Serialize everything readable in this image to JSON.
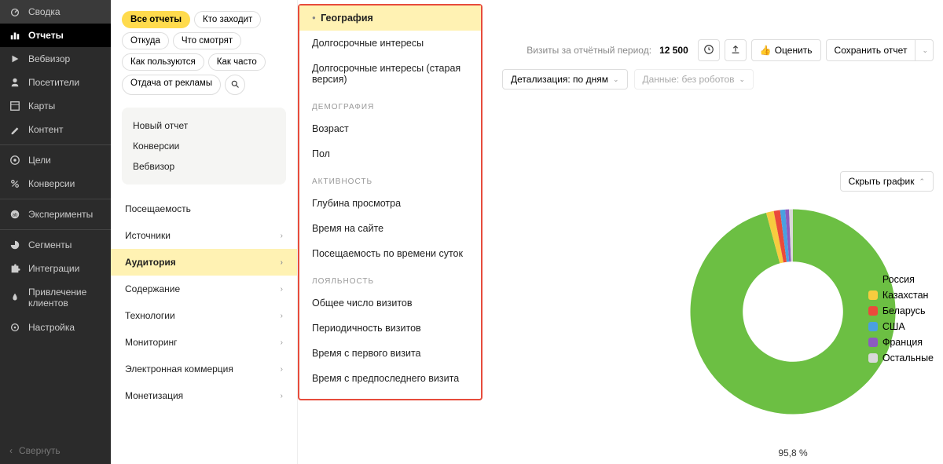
{
  "sidebar": {
    "items": [
      {
        "label": "Сводка",
        "icon": "gauge"
      },
      {
        "label": "Отчеты",
        "icon": "bars",
        "active": true
      },
      {
        "label": "Вебвизор",
        "icon": "play"
      },
      {
        "label": "Посетители",
        "icon": "person"
      },
      {
        "label": "Карты",
        "icon": "layout"
      },
      {
        "label": "Контент",
        "icon": "pen"
      }
    ],
    "group2": [
      {
        "label": "Цели",
        "icon": "target"
      },
      {
        "label": "Конверсии",
        "icon": "percent"
      }
    ],
    "group3": [
      {
        "label": "Эксперименты",
        "icon": "ab"
      }
    ],
    "group4": [
      {
        "label": "Сегменты",
        "icon": "pie"
      },
      {
        "label": "Интеграции",
        "icon": "puzzle"
      },
      {
        "label": "Привлечение клиентов",
        "icon": "flame"
      },
      {
        "label": "Настройка",
        "icon": "gear"
      }
    ],
    "collapse": "Свернуть"
  },
  "chips": [
    "Все отчеты",
    "Кто заходит",
    "Откуда",
    "Что смотрят",
    "Как пользуются",
    "Как часто",
    "Отдача от рекламы"
  ],
  "quick": [
    "Новый отчет",
    "Конверсии",
    "Вебвизор"
  ],
  "categories": [
    {
      "label": "Посещаемость",
      "arrow": false
    },
    {
      "label": "Источники",
      "arrow": true
    },
    {
      "label": "Аудитория",
      "arrow": true,
      "active": true
    },
    {
      "label": "Содержание",
      "arrow": true
    },
    {
      "label": "Технологии",
      "arrow": true
    },
    {
      "label": "Мониторинг",
      "arrow": true
    },
    {
      "label": "Электронная коммерция",
      "arrow": true
    },
    {
      "label": "Монетизация",
      "arrow": true
    }
  ],
  "submenu": {
    "top": [
      {
        "label": "География",
        "active": true
      },
      {
        "label": "Долгосрочные интересы"
      },
      {
        "label": "Долгосрочные интересы (старая версия)"
      }
    ],
    "groups": [
      {
        "header": "ДЕМОГРАФИЯ",
        "items": [
          "Возраст",
          "Пол"
        ]
      },
      {
        "header": "АКТИВНОСТЬ",
        "items": [
          "Глубина просмотра",
          "Время на сайте",
          "Посещаемость по времени суток"
        ]
      },
      {
        "header": "ЛОЯЛЬНОСТЬ",
        "items": [
          "Общее число визитов",
          "Периодичность визитов",
          "Время с первого визита",
          "Время с предпоследнего визита"
        ]
      }
    ]
  },
  "top": {
    "visits_label": "Визиты за отчётный период:",
    "visits_value": "12 500",
    "rate_btn": "Оценить",
    "save_btn": "Сохранить отчет"
  },
  "filters": {
    "detail": "Детализация: по дням",
    "robots": "Данные: без роботов"
  },
  "hide_chart": "Скрыть график",
  "chart_data": {
    "type": "pie",
    "title": "",
    "series": [
      {
        "name": "Россия",
        "value": 95.8,
        "color": "#6cbf43"
      },
      {
        "name": "Казахстан",
        "value": 1.2,
        "color": "#f7cc3f"
      },
      {
        "name": "Беларусь",
        "value": 1.0,
        "color": "#ea4a3b"
      },
      {
        "name": "США",
        "value": 0.8,
        "color": "#4aa0e0"
      },
      {
        "name": "Франция",
        "value": 0.6,
        "color": "#8c5bbf"
      },
      {
        "name": "Остальные",
        "value": 0.6,
        "color": "#d9d9d9"
      }
    ],
    "main_pct_label": "95,8 %"
  }
}
